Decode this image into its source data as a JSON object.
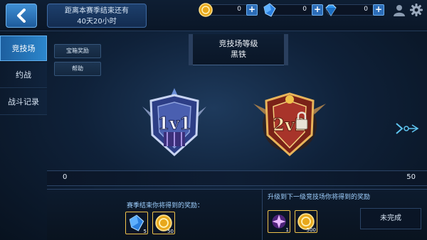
{
  "header": {
    "countdown_line1": "距离本赛季结束还有",
    "countdown_line2": "40天20小时",
    "currencies": [
      {
        "name": "gold",
        "value": "0",
        "color": "#f3c13a"
      },
      {
        "name": "crystal",
        "value": "0",
        "color": "#3c8ee8"
      },
      {
        "name": "diamond",
        "value": "0",
        "color": "#39a6f2"
      }
    ]
  },
  "sidebar": {
    "items": [
      {
        "label": "竞技场",
        "active": true
      },
      {
        "label": "约战",
        "active": false
      },
      {
        "label": "战斗记录",
        "active": false
      }
    ]
  },
  "buttons": {
    "chest_reward": "宝箱奖励",
    "help": "帮助"
  },
  "arena": {
    "title": "竞技场等级",
    "level": "黑铁",
    "badges": [
      {
        "label": "1v1",
        "locked": false
      },
      {
        "label": "2v2",
        "locked": true
      }
    ]
  },
  "progress": {
    "min_label": "0",
    "max_label": "50",
    "value": 0
  },
  "season_rewards": {
    "title": "赛季结束你将得到的奖励：",
    "items": [
      {
        "icon": "crystal-icon",
        "count": "5"
      },
      {
        "icon": "gold-coin-icon",
        "count": "50"
      }
    ]
  },
  "next_level_rewards": {
    "title": "升级到下一级竞技场你将得到的奖励",
    "items": [
      {
        "icon": "purple-star-icon",
        "count": "1"
      },
      {
        "icon": "gold-coin-icon",
        "count": "500"
      }
    ],
    "status": "未完成"
  }
}
